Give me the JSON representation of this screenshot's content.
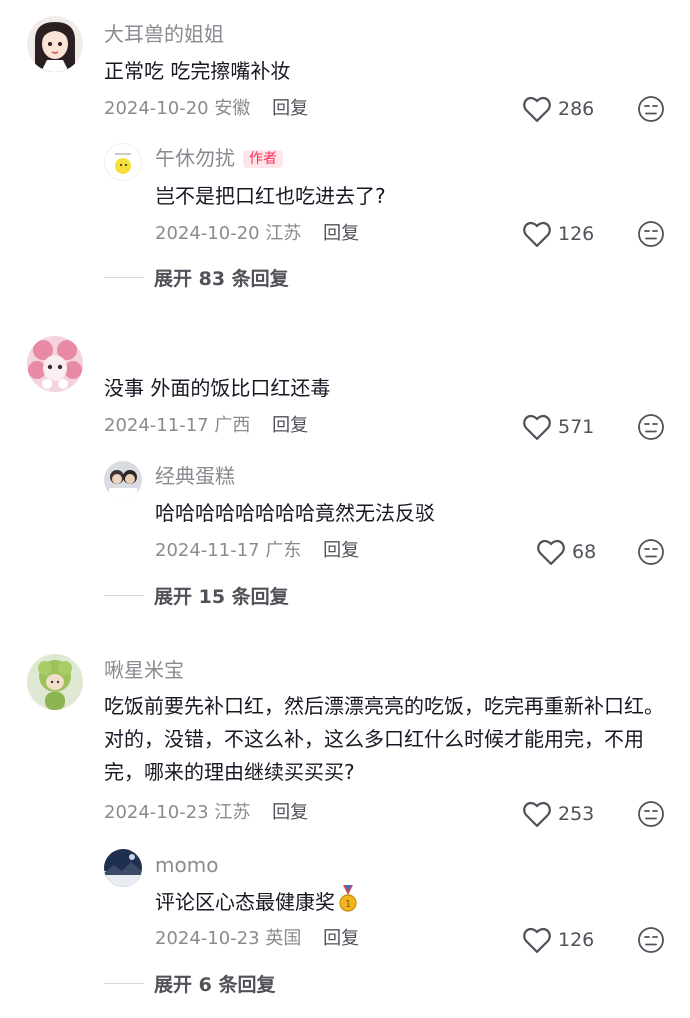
{
  "comments": [
    {
      "user": "大耳兽的姐姐",
      "text": "正常吃 吃完擦嘴补妆",
      "date": "2024-10-20",
      "location": "安徽",
      "reply_label": "回复",
      "likes": "286",
      "replies": [
        {
          "user": "午休勿扰",
          "badge": "作者",
          "text": "岂不是把口红也吃进去了?",
          "date": "2024-10-20",
          "location": "江苏",
          "reply_label": "回复",
          "likes": "126"
        }
      ],
      "expand_label": "展开 83 条回复"
    },
    {
      "user": "",
      "text": "没事 外面的饭比口红还毒",
      "date": "2024-11-17",
      "location": "广西",
      "reply_label": "回复",
      "likes": "571",
      "replies": [
        {
          "user": "经典蛋糕",
          "text": "哈哈哈哈哈哈哈哈竟然无法反驳",
          "date": "2024-11-17",
          "location": "广东",
          "reply_label": "回复",
          "likes": "68"
        }
      ],
      "expand_label": "展开 15 条回复"
    },
    {
      "user": "啾星米宝",
      "text": "吃饭前要先补口红，然后漂漂亮亮的吃饭，吃完再重新补口红。对的，没错，不这么补，这么多口红什么时候才能用完，不用完，哪来的理由继续买买买?",
      "date": "2024-10-23",
      "location": "江苏",
      "reply_label": "回复",
      "likes": "253",
      "replies": [
        {
          "user": "momo",
          "text": "评论区心态最健康奖",
          "date": "2024-10-23",
          "location": "英国",
          "reply_label": "回复",
          "likes": "126",
          "icon": "gold-medal-icon"
        }
      ],
      "expand_label": "展开 6 条回复"
    }
  ],
  "icons": {
    "like": "heart-outline-icon",
    "dislike": "unamused-face-icon"
  },
  "colors": {
    "author_badge": "#fe2c55",
    "muted_text": "#8a8b91"
  }
}
